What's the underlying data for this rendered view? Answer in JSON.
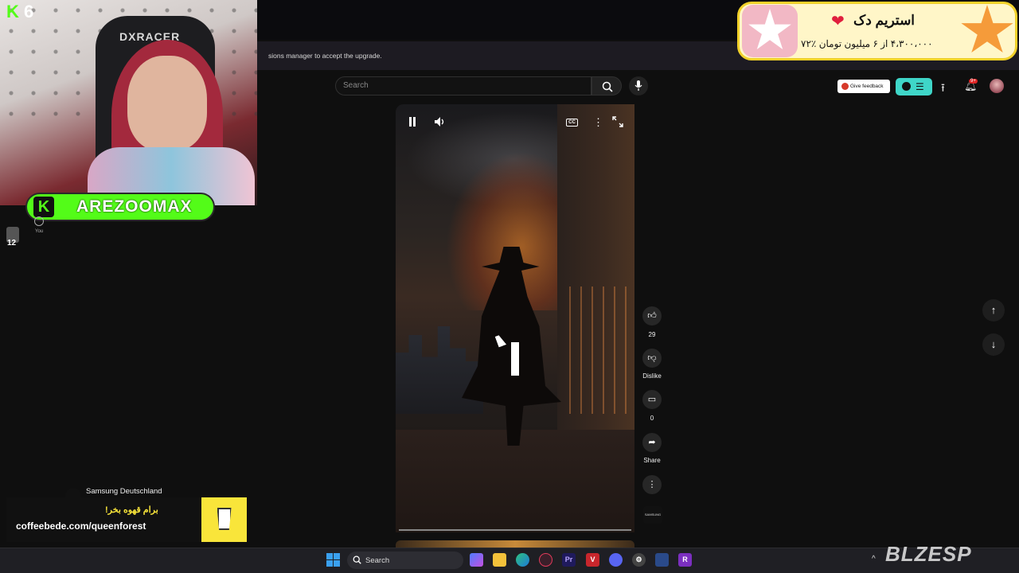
{
  "stream": {
    "counter": "6",
    "streamer_name": "AREZOOMAX",
    "chair_brand": "DXRACER"
  },
  "browser": {
    "notice": "sions manager to accept the upgrade."
  },
  "donation": {
    "title": "استریم دک",
    "progress_text": "۴،۳۰۰،۰۰۰ از ۶ میلیون تومان",
    "percent": "٪۷۲"
  },
  "youtube": {
    "search_placeholder": "Search",
    "feedback_label": "Give feedback",
    "notifications_badge": "9+",
    "sidebar_you": "You",
    "sidebar_num": "12"
  },
  "short": {
    "cc_label": "CC",
    "likes": "29",
    "dislike_label": "Dislike",
    "comments": "0",
    "share_label": "Share",
    "channel_thumb_text": "SAMSUNG",
    "channel_name": "Samsung Deutschland"
  },
  "coffee": {
    "title": "برام قهوه بخر!",
    "url": "coffeebede.com/queenforest"
  },
  "taskbar": {
    "search_label": "Search",
    "watermark": "BLZESP"
  }
}
